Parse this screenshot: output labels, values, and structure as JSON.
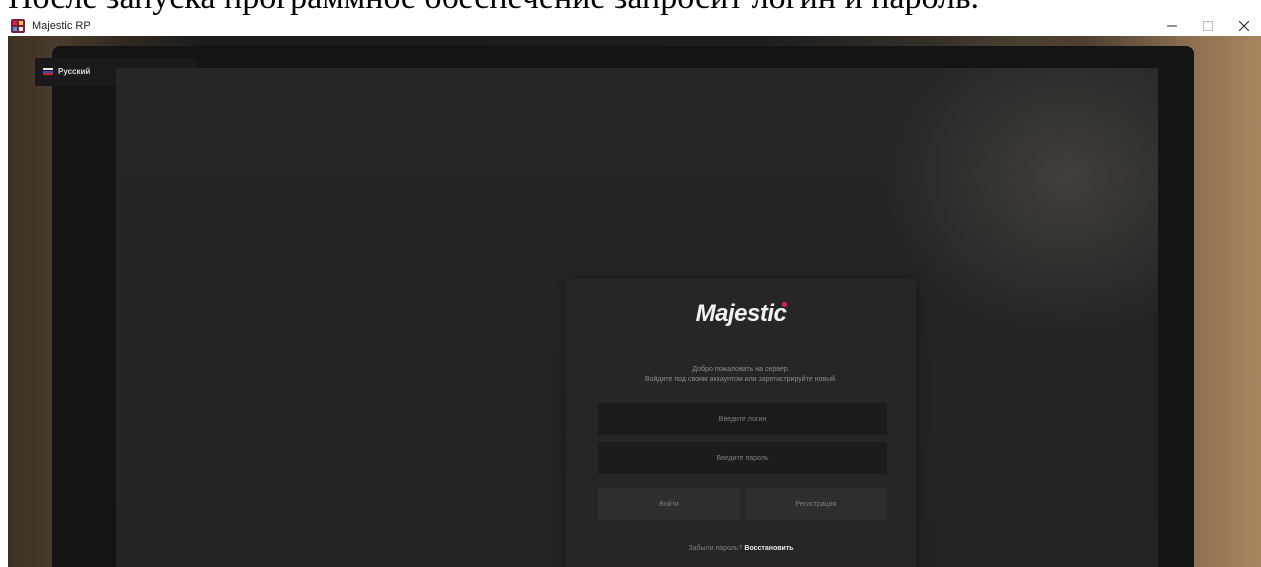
{
  "document": {
    "caption": "После запуска программное обеспечение запросит логин и пароль."
  },
  "window": {
    "title": "Majestic RP",
    "icon": "majestic-rp-icon",
    "controls": [
      "minimize-icon",
      "maximize-icon",
      "close-icon"
    ]
  },
  "language": {
    "selected": "Русский",
    "flag": "russia-flag-icon"
  },
  "login_panel": {
    "logo": "Majestic",
    "welcome_line1": "Добро пожаловать на сервер.",
    "welcome_line2": "Войдите под своим аккаунтом или зарегистрируйте новый.",
    "login_placeholder": "Введите логин",
    "password_placeholder": "Введите пароль",
    "signin_label": "Войти",
    "register_label": "Регистрация",
    "forgot_question": "Забыли пароль?",
    "restore_label": "Восстановить"
  },
  "colors": {
    "accent": "#e0195c",
    "panel": "#262626",
    "field": "#1c1c1c",
    "button": "#2e2e2e"
  }
}
